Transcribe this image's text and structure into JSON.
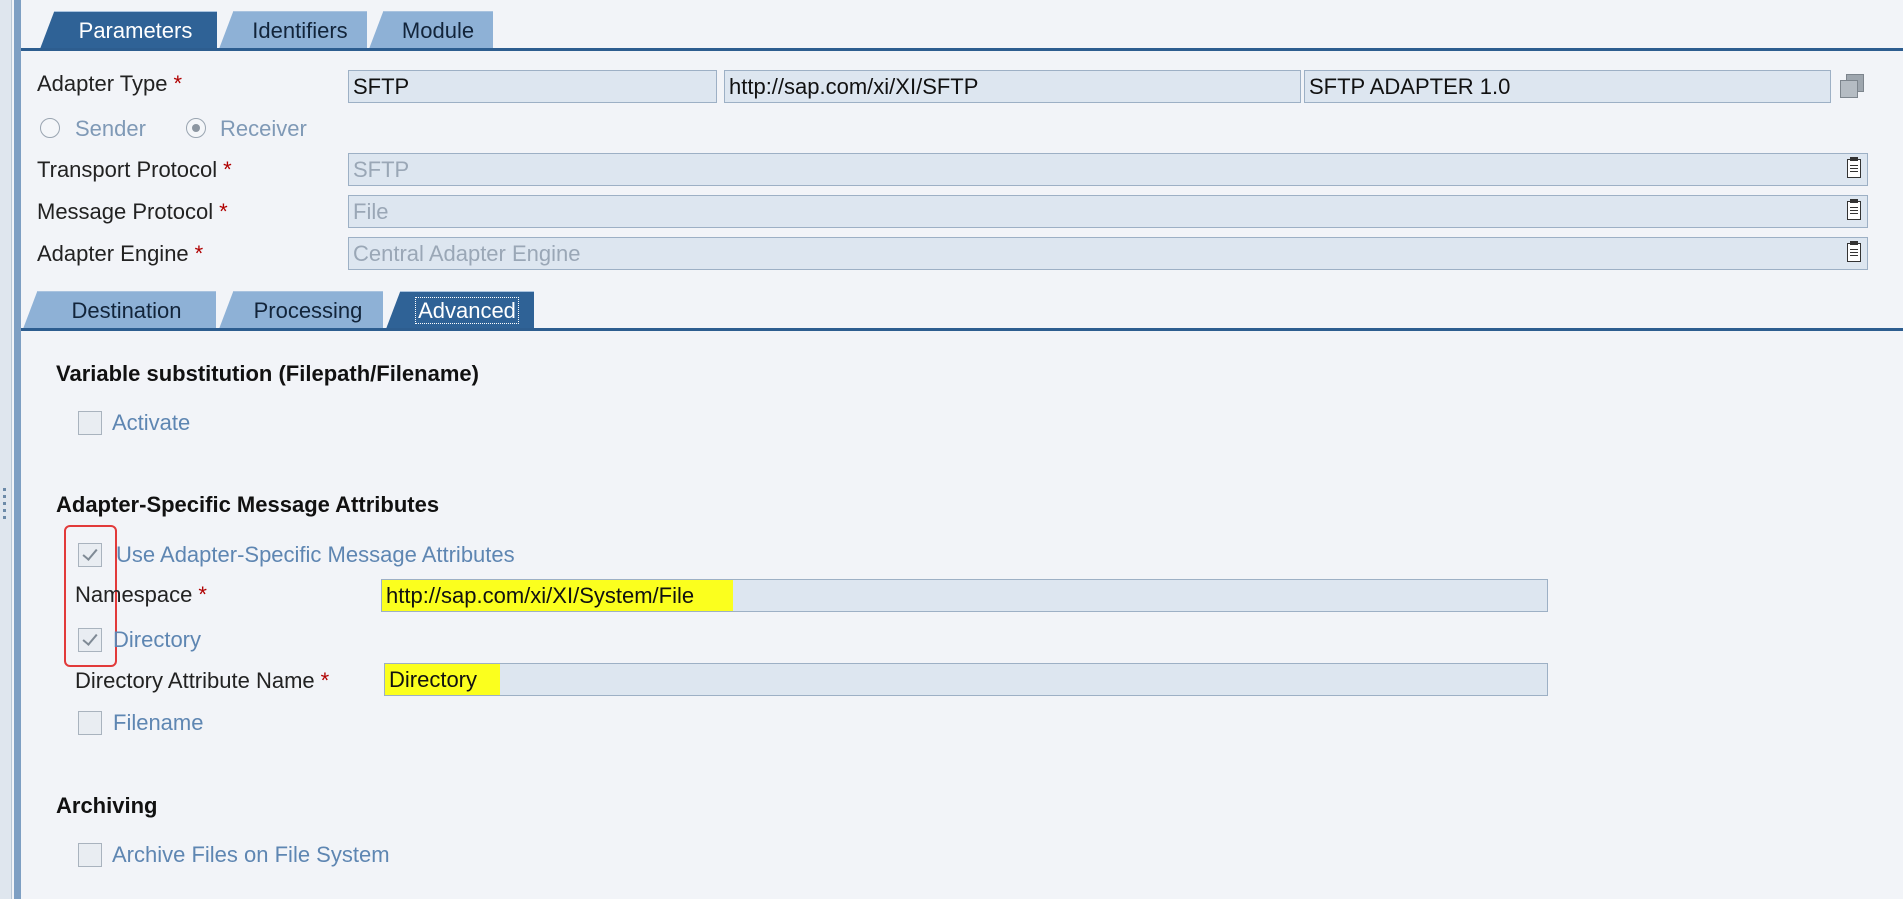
{
  "top_tabs": [
    {
      "label": "Parameters",
      "active": true
    },
    {
      "label": "Identifiers",
      "active": false
    },
    {
      "label": "Module",
      "active": false
    }
  ],
  "adapter_type": {
    "label": "Adapter Type",
    "required_mark": "*",
    "name": "SFTP",
    "namespace": "http://sap.com/xi/XI/SFTP",
    "software_component": "SFTP ADAPTER 1.0"
  },
  "direction": {
    "sender_label": "Sender",
    "receiver_label": "Receiver",
    "selected": "Receiver"
  },
  "transport_protocol": {
    "label": "Transport Protocol",
    "required_mark": "*",
    "value": "SFTP"
  },
  "message_protocol": {
    "label": "Message Protocol",
    "required_mark": "*",
    "value": "File"
  },
  "adapter_engine": {
    "label": "Adapter Engine",
    "required_mark": "*",
    "value": "Central Adapter Engine"
  },
  "sub_tabs": [
    {
      "label": "Destination",
      "active": false
    },
    {
      "label": "Processing",
      "active": false
    },
    {
      "label": "Advanced",
      "active": true
    }
  ],
  "variable_substitution": {
    "title": "Variable substitution (Filepath/Filename)",
    "activate_label": "Activate",
    "activate_checked": false
  },
  "asma": {
    "title": "Adapter-Specific Message Attributes",
    "use_label": "Use Adapter-Specific Message Attributes",
    "use_checked": true,
    "namespace_label": "Namespace",
    "namespace_required_mark": "*",
    "namespace_value": "http://sap.com/xi/XI/System/File",
    "directory_label": "Directory",
    "directory_checked": true,
    "directory_attr_label": "Directory Attribute Name",
    "directory_attr_required_mark": "*",
    "directory_attr_value": "Directory",
    "filename_label": "Filename",
    "filename_checked": false
  },
  "archiving": {
    "title": "Archiving",
    "archive_label": "Archive Files on File System",
    "archive_checked": false
  },
  "colors": {
    "active_tab": "#2f6296",
    "inactive_tab": "#8eb1d6",
    "field_bg": "#dde6f0",
    "highlight": "#fbff1e",
    "annotation_red": "#e23a3a"
  }
}
